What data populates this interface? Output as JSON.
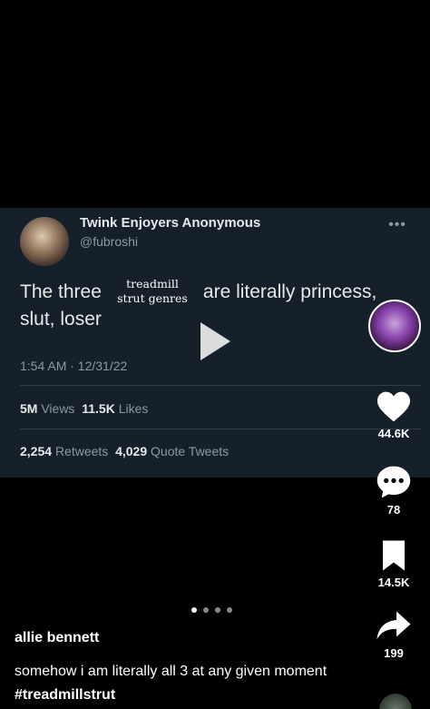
{
  "tweet": {
    "display_name": "Twink Enjoyers Anonymous",
    "handle": "@fubroshi",
    "more": "•••",
    "text_before": "The three",
    "text_after": "are literally princess, slut, loser",
    "overlay_line1": "treadmill",
    "overlay_line2": "strut genres",
    "timestamp": "1:54 AM · 12/31/22",
    "views_count": "5M",
    "views_label": "Views",
    "likes_count": "11.5K",
    "likes_label": "Likes",
    "retweets_count": "2,254",
    "retweets_label": "Retweets",
    "quotes_count": "4,029",
    "quotes_label": "Quote Tweets"
  },
  "actions": {
    "likes": "44.6K",
    "comments": "78",
    "saves": "14.5K",
    "shares": "199"
  },
  "post": {
    "username": "allie bennett",
    "caption": "somehow i am literally all 3 at any given moment",
    "hashtag": "#treadmillstrut"
  },
  "carousel": {
    "total": 4,
    "active_index": 0
  },
  "icons": {
    "play": "play-icon",
    "heart": "heart-icon",
    "comment": "comment-icon",
    "bookmark": "bookmark-icon",
    "share": "share-icon"
  }
}
